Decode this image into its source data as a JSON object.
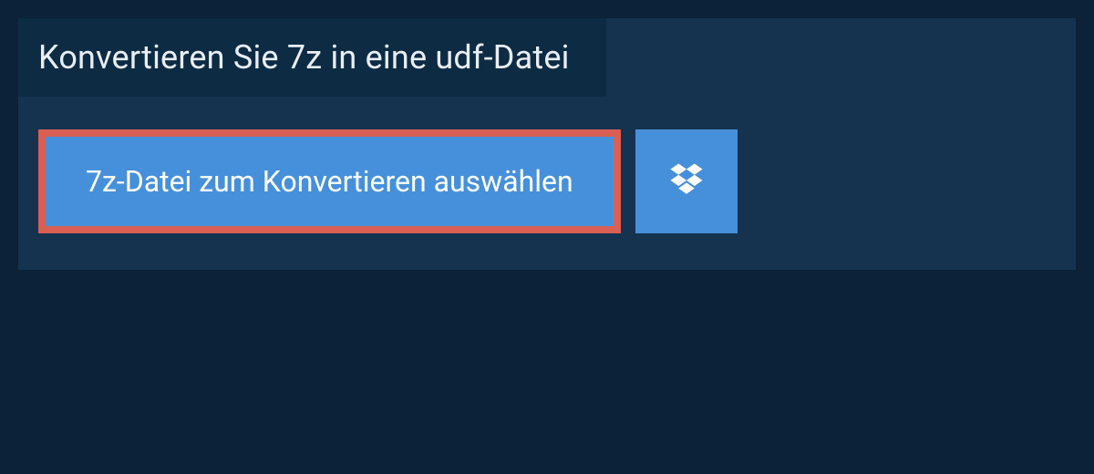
{
  "header": {
    "title": "Konvertieren Sie 7z in eine udf-Datei"
  },
  "actions": {
    "select_file_label": "7z-Datei zum Konvertieren auswählen"
  },
  "colors": {
    "page_bg": "#0b2239",
    "panel_bg": "#15324f",
    "header_bg": "#0e2b44",
    "button_bg": "#4690db",
    "highlight_border": "#d95f55",
    "text_light": "#ffffff"
  }
}
